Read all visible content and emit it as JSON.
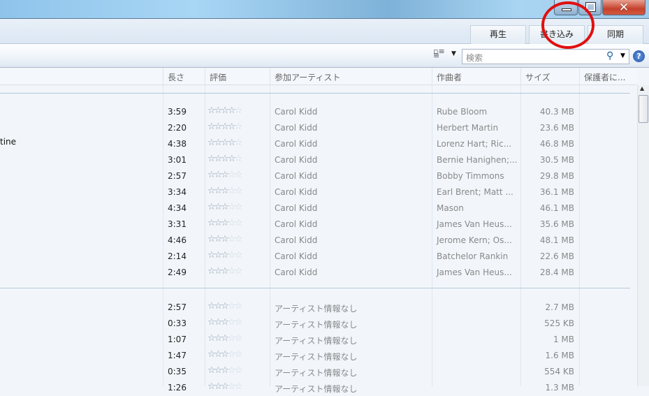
{
  "window": {
    "close": "✕"
  },
  "tabs": [
    {
      "label": "再生"
    },
    {
      "label": "書き込み"
    },
    {
      "label": "同期"
    }
  ],
  "toolbar": {
    "search_placeholder": "検索"
  },
  "columns": {
    "length": "長さ",
    "rating": "評価",
    "artist": "参加アーティスト",
    "composer": "作曲者",
    "size": "サイズ",
    "protected": "保護者に..."
  },
  "partial_title": "tine",
  "group1": [
    {
      "length": "3:59",
      "rating": 4,
      "artist": "Carol Kidd",
      "composer": "Rube Bloom",
      "size": "40.3 MB"
    },
    {
      "length": "2:20",
      "rating": 4,
      "artist": "Carol Kidd",
      "composer": "Herbert Martin",
      "size": "23.6 MB"
    },
    {
      "length": "4:38",
      "rating": 4,
      "artist": "Carol Kidd",
      "composer": "Lorenz Hart; Ric...",
      "size": "46.8 MB"
    },
    {
      "length": "3:01",
      "rating": 4,
      "artist": "Carol Kidd",
      "composer": "Bernie Hanighen;...",
      "size": "30.5 MB"
    },
    {
      "length": "2:57",
      "rating": 3,
      "artist": "Carol Kidd",
      "composer": "Bobby Timmons",
      "size": "29.8 MB"
    },
    {
      "length": "3:34",
      "rating": 3,
      "artist": "Carol Kidd",
      "composer": "Earl Brent; Matt ...",
      "size": "36.1 MB"
    },
    {
      "length": "4:34",
      "rating": 3,
      "artist": "Carol Kidd",
      "composer": "Mason",
      "size": "46.1 MB"
    },
    {
      "length": "3:31",
      "rating": 3,
      "artist": "Carol Kidd",
      "composer": "James Van Heus...",
      "size": "35.6 MB"
    },
    {
      "length": "4:46",
      "rating": 3,
      "artist": "Carol Kidd",
      "composer": "Jerome Kern; Os...",
      "size": "48.1 MB"
    },
    {
      "length": "2:14",
      "rating": 3,
      "artist": "Carol Kidd",
      "composer": "Batchelor Rankin",
      "size": "22.6 MB"
    },
    {
      "length": "2:49",
      "rating": 3,
      "artist": "Carol Kidd",
      "composer": "James Van Heus...",
      "size": "28.4 MB"
    }
  ],
  "group2": [
    {
      "length": "2:57",
      "rating": 3,
      "artist": "アーティスト情報なし",
      "size": "2.7 MB"
    },
    {
      "length": "0:33",
      "rating": 3,
      "artist": "アーティスト情報なし",
      "size": "525 KB"
    },
    {
      "length": "1:07",
      "rating": 3,
      "artist": "アーティスト情報なし",
      "size": "1 MB"
    },
    {
      "length": "1:47",
      "rating": 3,
      "artist": "アーティスト情報なし",
      "size": "1.6 MB"
    },
    {
      "length": "0:35",
      "rating": 3,
      "artist": "アーティスト情報なし",
      "size": "554 KB"
    },
    {
      "length": "1:26",
      "rating": 3,
      "artist": "アーティスト情報なし",
      "size": "1.3 MB"
    }
  ]
}
